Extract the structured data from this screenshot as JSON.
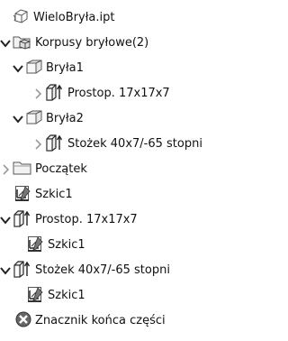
{
  "tree": {
    "root": {
      "label": "WieloBryła.ipt",
      "icon": "part-file-icon"
    },
    "solid_bodies": {
      "label": "Korpusy bryłowe(2)",
      "icon": "folder-solids-icon",
      "expanded": true
    },
    "body1": {
      "label": "Bryła1",
      "icon": "solid-body-icon",
      "expanded": true
    },
    "body1_feature": {
      "label": "Prostop. 17x17x7",
      "icon": "extrude-icon",
      "expanded": false
    },
    "body2": {
      "label": "Bryła2",
      "icon": "solid-body-icon",
      "expanded": true
    },
    "body2_feature": {
      "label": "Stożek 40x7/-65 stopni",
      "icon": "extrude-icon",
      "expanded": false
    },
    "origin": {
      "label": "Początek",
      "icon": "folder-icon",
      "expanded": false
    },
    "sketch1": {
      "label": "Szkic1",
      "icon": "sketch-icon"
    },
    "extrude1": {
      "label": "Prostop. 17x17x7",
      "icon": "extrude-icon",
      "expanded": true
    },
    "extrude1_sketch": {
      "label": "Szkic1",
      "icon": "sketch-icon"
    },
    "extrude2": {
      "label": "Stożek 40x7/-65 stopni",
      "icon": "extrude-icon",
      "expanded": true
    },
    "extrude2_sketch": {
      "label": "Szkic1",
      "icon": "sketch-icon"
    },
    "end_of_part": {
      "label": "Znacznik końca części",
      "icon": "end-of-part-icon"
    }
  }
}
